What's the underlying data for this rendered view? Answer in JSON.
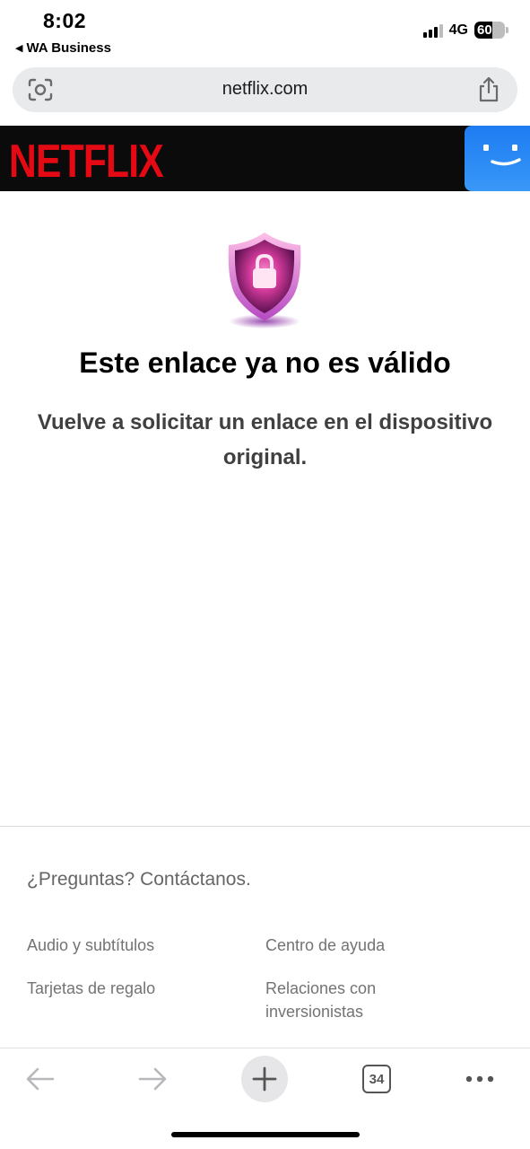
{
  "status_bar": {
    "time": "8:02",
    "back_app": "WA Business",
    "network": "4G",
    "battery_percent": 60,
    "battery_label": "60"
  },
  "browser": {
    "url": "netflix.com"
  },
  "header": {
    "logo_text": "NETFLIX",
    "brand_color": "#e50914",
    "avatar_color": "#2d8cf5"
  },
  "message": {
    "title": "Este enlace ya no es válido",
    "subtitle": "Vuelve a solicitar un enlace en el dispositivo original."
  },
  "footer": {
    "contact": "¿Preguntas? Contáctanos.",
    "links": [
      "Audio y subtítulos",
      "Centro de ayuda",
      "Tarjetas de regalo",
      "Relaciones con inversionistas"
    ]
  },
  "toolbar": {
    "tab_count": "34",
    "icons": [
      "back-arrow-icon",
      "forward-arrow-icon",
      "plus-icon",
      "tabs-icon",
      "more-icon"
    ]
  }
}
